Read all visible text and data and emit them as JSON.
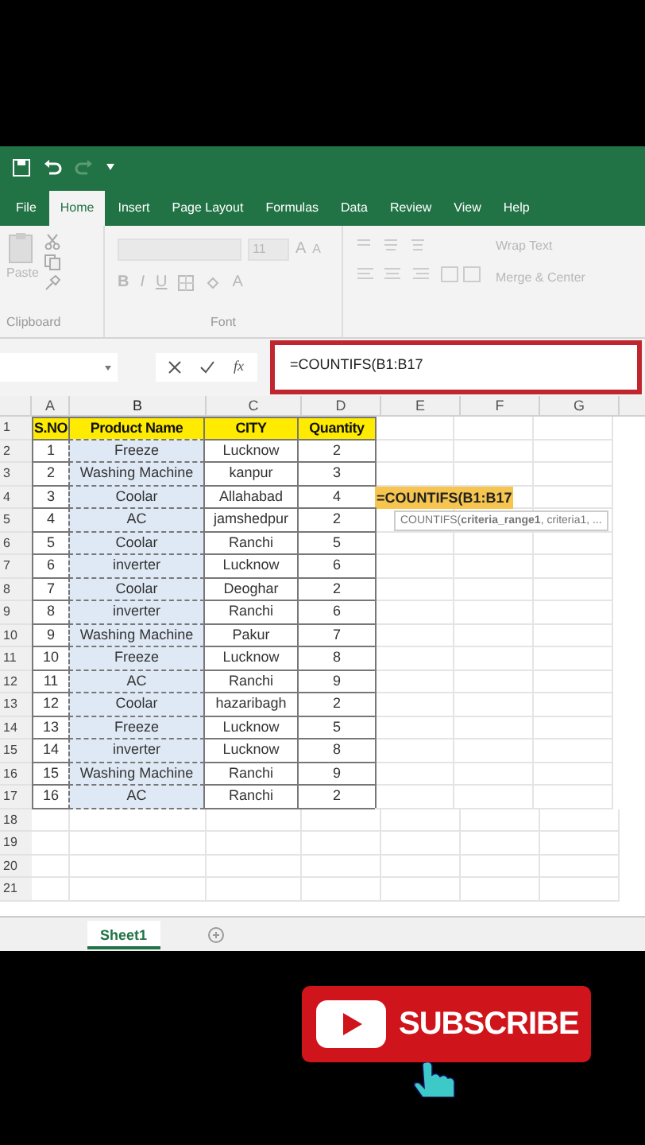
{
  "ribbon_tabs": [
    {
      "label": "File",
      "selected": false
    },
    {
      "label": "Home",
      "selected": true
    },
    {
      "label": "Insert",
      "selected": false
    },
    {
      "label": "Page Layout",
      "selected": false
    },
    {
      "label": "Formulas",
      "selected": false
    },
    {
      "label": "Data",
      "selected": false
    },
    {
      "label": "Review",
      "selected": false
    },
    {
      "label": "View",
      "selected": false
    },
    {
      "label": "Help",
      "selected": false
    }
  ],
  "ribbon": {
    "clipboard": {
      "paste_label": "Paste",
      "group_label": "Clipboard"
    },
    "font": {
      "size": "11",
      "grow": "A",
      "shrink": "A",
      "format_buttons": [
        "B",
        "I",
        "U"
      ],
      "color_button": "A",
      "group_label": "Font"
    },
    "alignment": {
      "wrap_text": "Wrap Text",
      "merge": "Merge & Center"
    }
  },
  "formula_bar": {
    "fx": "fx",
    "formula": "=COUNTIFS(B1:B17"
  },
  "sheet": {
    "columns": [
      {
        "label": "A",
        "selected": false
      },
      {
        "label": "B",
        "selected": true
      },
      {
        "label": "C",
        "selected": false
      },
      {
        "label": "D",
        "selected": false
      },
      {
        "label": "E",
        "selected": false
      },
      {
        "label": "F",
        "selected": false
      },
      {
        "label": "G",
        "selected": false
      }
    ],
    "rows": [
      {
        "number": "1",
        "kind": "header",
        "cells": [
          "S.NO",
          "Product Name",
          "CITY",
          "Quantity"
        ]
      },
      {
        "number": "2",
        "kind": "data",
        "cells": [
          "1",
          "Freeze",
          "Lucknow",
          "2"
        ]
      },
      {
        "number": "3",
        "kind": "data",
        "cells": [
          "2",
          "Washing Machine",
          "kanpur",
          "3"
        ]
      },
      {
        "number": "4",
        "kind": "data",
        "cells": [
          "3",
          "Coolar",
          "Allahabad",
          "4"
        ],
        "editing_cell": {
          "text": "=COUNTIFS(B1:B17",
          "tooltip": "COUNTIFS(**criteria_range1**, criteria1, ..."
        }
      },
      {
        "number": "5",
        "kind": "data",
        "cells": [
          "4",
          "AC",
          "jamshedpur",
          "2"
        ]
      },
      {
        "number": "6",
        "kind": "data",
        "cells": [
          "5",
          "Coolar",
          "Ranchi",
          "5"
        ]
      },
      {
        "number": "7",
        "kind": "data",
        "cells": [
          "6",
          "inverter",
          "Lucknow",
          "6"
        ]
      },
      {
        "number": "8",
        "kind": "data",
        "cells": [
          "7",
          "Coolar",
          "Deoghar",
          "2"
        ]
      },
      {
        "number": "9",
        "kind": "data",
        "cells": [
          "8",
          "inverter",
          "Ranchi",
          "6"
        ]
      },
      {
        "number": "10",
        "kind": "data",
        "cells": [
          "9",
          "Washing Machine",
          "Pakur",
          "7"
        ]
      },
      {
        "number": "11",
        "kind": "data",
        "cells": [
          "10",
          "Freeze",
          "Lucknow",
          "8"
        ]
      },
      {
        "number": "12",
        "kind": "data",
        "cells": [
          "11",
          "AC",
          "Ranchi",
          "9"
        ]
      },
      {
        "number": "13",
        "kind": "data",
        "cells": [
          "12",
          "Coolar",
          "hazaribagh",
          "2"
        ]
      },
      {
        "number": "14",
        "kind": "data",
        "cells": [
          "13",
          "Freeze",
          "Lucknow",
          "5"
        ]
      },
      {
        "number": "15",
        "kind": "data",
        "cells": [
          "14",
          "inverter",
          "Lucknow",
          "8"
        ]
      },
      {
        "number": "16",
        "kind": "data",
        "cells": [
          "15",
          "Washing Machine",
          "Ranchi",
          "9"
        ]
      },
      {
        "number": "17",
        "kind": "data",
        "cells": [
          "16",
          "AC",
          "Ranchi",
          "2"
        ]
      },
      {
        "number": "18",
        "kind": "empty",
        "cells": []
      },
      {
        "number": "19",
        "kind": "empty",
        "cells": []
      },
      {
        "number": "20",
        "kind": "empty",
        "cells": []
      },
      {
        "number": "21",
        "kind": "empty",
        "cells": []
      }
    ]
  },
  "sheet_tabs": [
    {
      "label": "Sheet1",
      "selected": true
    }
  ],
  "subscribe_button": {
    "label": "SUBSCRIBE"
  }
}
